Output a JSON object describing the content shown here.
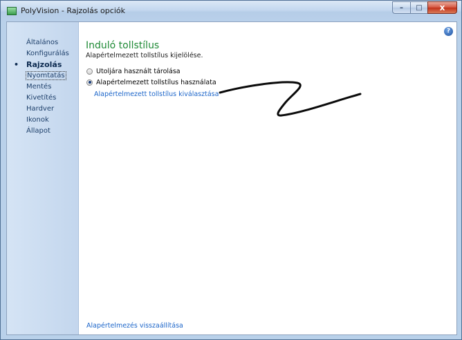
{
  "window": {
    "title": "PolyVision - Rajzolás opciók"
  },
  "titlebar_buttons": {
    "minimize": "–",
    "maximize": "□",
    "close": "x"
  },
  "help": {
    "glyph": "?"
  },
  "sidebar": {
    "bullet": "•",
    "items": [
      {
        "label": "Általános"
      },
      {
        "label": "Konfigurálás"
      },
      {
        "label": "Rajzolás"
      },
      {
        "label": "Nyomtatás"
      },
      {
        "label": "Mentés"
      },
      {
        "label": "Kivetítés"
      },
      {
        "label": "Hardver"
      },
      {
        "label": "Ikonok"
      },
      {
        "label": "Állapot"
      }
    ]
  },
  "main": {
    "title": "Induló tollstílus",
    "subtitle": "Alapértelmezett tollstílus kijelölése.",
    "options": [
      {
        "label": "Utoljára használt tárolása",
        "checked": false
      },
      {
        "label": "Alapértelmezett tollstílus használata",
        "checked": true
      }
    ],
    "choose_link": "Alapértelmezett tollstílus kiválasztása",
    "reset_link": "Alapértelmezés visszaállítása"
  },
  "colors": {
    "heading": "#1e8a35",
    "link": "#1a64c9",
    "sidebar_text": "#1d3f6a"
  }
}
